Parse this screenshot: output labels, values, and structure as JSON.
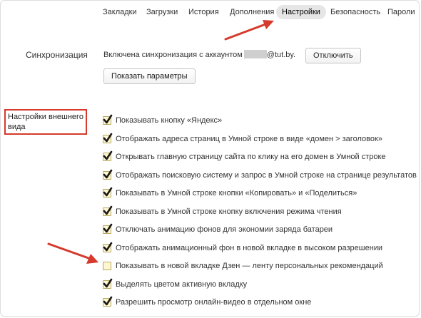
{
  "nav": {
    "items": [
      {
        "label": "Закладки",
        "active": false
      },
      {
        "label": "Загрузки",
        "active": false
      },
      {
        "label": "История",
        "active": false
      },
      {
        "label": "Дополнения",
        "active": false
      },
      {
        "label": "Настройки",
        "active": true
      },
      {
        "label": "Безопасность",
        "active": false
      },
      {
        "label": "Пароли",
        "active": false
      }
    ]
  },
  "sync": {
    "label": "Синхронизация",
    "status_prefix": "Включена синхронизация с аккаунтом",
    "email_domain": "@tut.by.",
    "disconnect_button": "Отключить",
    "show_params_button": "Показать параметры"
  },
  "appearance": {
    "label_line1": "Настройки внешнего",
    "label_line2": "вида",
    "options": [
      {
        "label": "Показывать кнопку «Яндекс»",
        "checked": true
      },
      {
        "label": "Отображать адреса страниц в Умной строке в виде «домен > заголовок»",
        "checked": true
      },
      {
        "label": "Открывать главную страницу сайта по клику на его домен в Умной строке",
        "checked": true
      },
      {
        "label": "Отображать поисковую систему и запрос в Умной строке на странице результатов",
        "checked": true
      },
      {
        "label": "Показывать в Умной строке кнопки «Копировать» и «Поделиться»",
        "checked": true
      },
      {
        "label": "Показывать в Умной строке кнопку включения режима чтения",
        "checked": true
      },
      {
        "label": "Отключать анимацию фонов для экономии заряда батареи",
        "checked": true
      },
      {
        "label": "Отображать анимационный фон в новой вкладке в высоком разрешении",
        "checked": true
      },
      {
        "label": "Показывать в новой вкладке Дзен — ленту персональных рекомендаций",
        "checked": false
      },
      {
        "label": "Выделять цветом активную вкладку",
        "checked": true
      },
      {
        "label": "Разрешить просмотр онлайн-видео в отдельном окне",
        "checked": true
      }
    ]
  },
  "colors": {
    "annotation_red": "#d53a2c",
    "checkbox_fill": "#fff7d2",
    "checkmark": "#1a1a1a"
  }
}
